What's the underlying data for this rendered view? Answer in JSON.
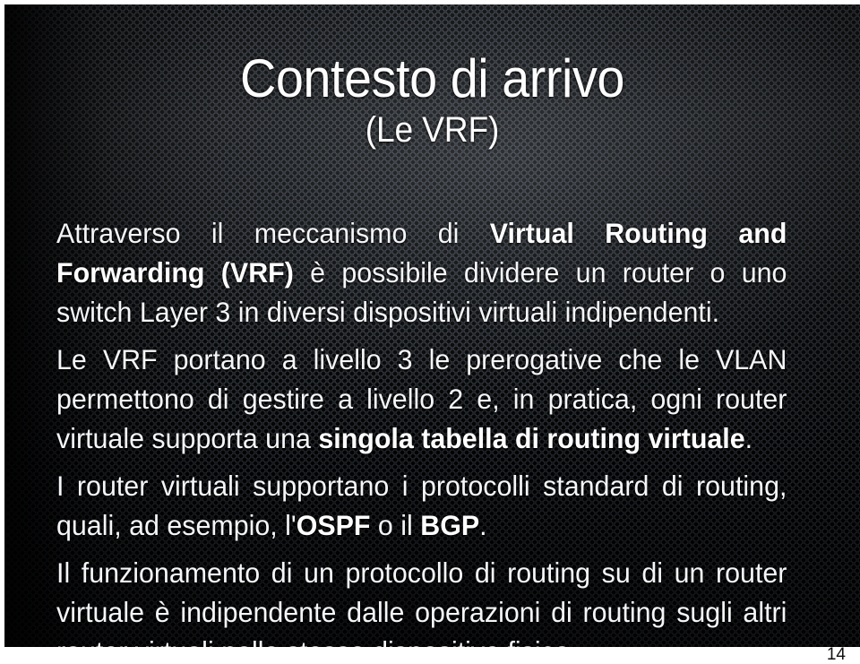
{
  "slide": {
    "title": "Contesto di arrivo",
    "subtitle": "(Le VRF)",
    "page_number": "14",
    "background": {
      "texture": "perforated-metal-mesh",
      "base_color": "#0b0d10",
      "text_color": "#f4f6f8",
      "accent_color": "#ffffff"
    },
    "paragraphs": [
      {
        "id": "p1",
        "runs": [
          {
            "text": "Attraverso il meccanismo di ",
            "bold": false
          },
          {
            "text": "Virtual Routing and Forwarding (VRF)",
            "bold": true
          },
          {
            "text": " è possibile dividere un router o uno switch Layer 3 in diversi dispositivi virtuali indipendenti.",
            "bold": false
          }
        ]
      },
      {
        "id": "p2",
        "runs": [
          {
            "text": "Le VRF portano a livello 3 le prerogative che le VLAN permettono di gestire a livello 2 e, in pratica, ogni router virtuale supporta una ",
            "bold": false
          },
          {
            "text": "singola tabella di routing virtuale",
            "bold": true
          },
          {
            "text": ".",
            "bold": false
          }
        ]
      },
      {
        "id": "p3",
        "runs": [
          {
            "text": "I router virtuali supportano i protocolli standard di routing, quali, ad esempio, l'",
            "bold": false
          },
          {
            "text": "OSPF",
            "bold": true
          },
          {
            "text": " o il ",
            "bold": false
          },
          {
            "text": "BGP",
            "bold": true
          },
          {
            "text": ".",
            "bold": false
          }
        ]
      },
      {
        "id": "p4",
        "runs": [
          {
            "text": "Il funzionamento di un protocollo di routing su di un router virtuale è indipendente dalle operazioni di routing sugli altri router virtuali nello stesso dispositivo fisico.",
            "bold": false
          }
        ]
      }
    ]
  }
}
